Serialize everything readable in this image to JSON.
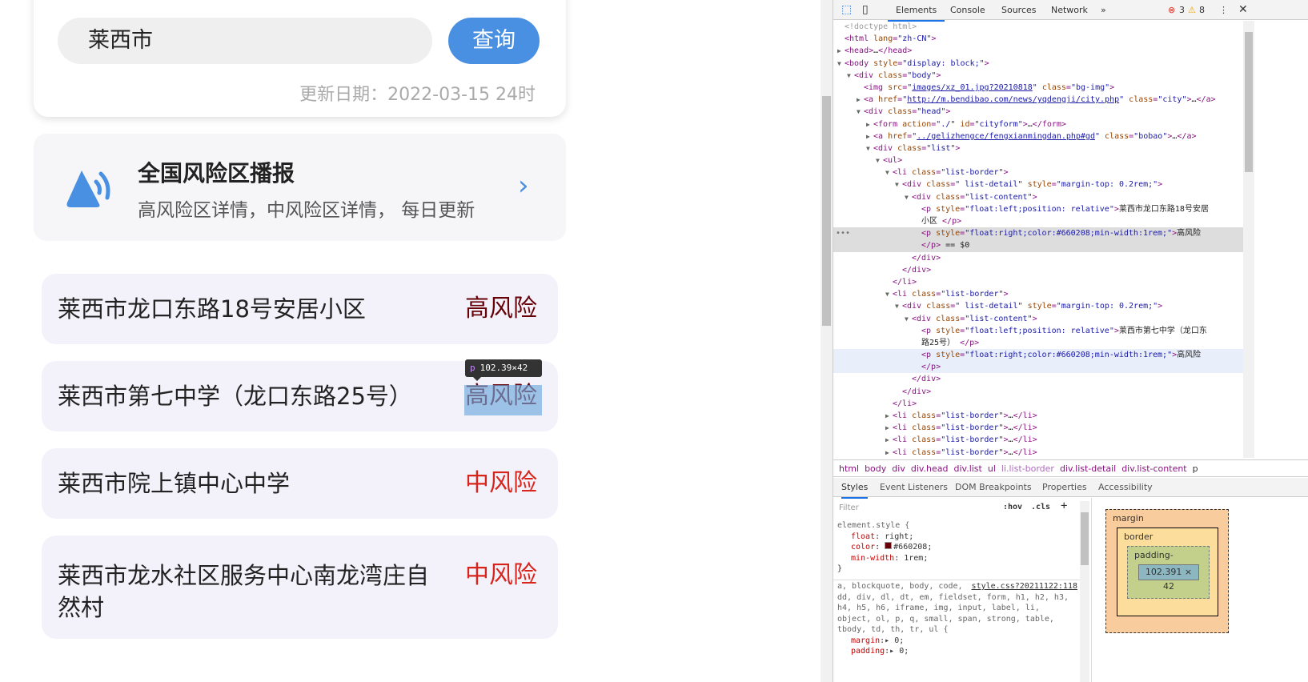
{
  "page": {
    "search_value": "莱西市",
    "search_button": "查询",
    "update_date": "更新日期：2022-03-15 24时",
    "bobao": {
      "title": "全国风险区播报",
      "subtitle": "高风险区详情，中风险区详情， 每日更新",
      "icon": "broadcast-icon"
    },
    "items": [
      {
        "name": "莱西市龙口东路18号安居小区",
        "risk": "高风险",
        "color": "#660208"
      },
      {
        "name": "莱西市第七中学（龙口东路25号）",
        "risk": "高风险",
        "color": "#660208"
      },
      {
        "name": "莱西市院上镇中心中学",
        "risk": "中风险",
        "color": "#d9241c"
      },
      {
        "name": "莱西市龙水社区服务中心南龙湾庄自然村",
        "risk": "中风险",
        "color": "#d9241c"
      }
    ],
    "tooltip": {
      "tag": "p",
      "size": "102.39×42"
    }
  },
  "devtools": {
    "tabs": [
      "Elements",
      "Console",
      "Sources",
      "Network"
    ],
    "errors": "3",
    "warnings": "8",
    "tree": [
      {
        "i": 0,
        "t": "<!doctype html>",
        "c": 1
      },
      {
        "i": 0,
        "t": "<html lang=\"zh-CN\">"
      },
      {
        "i": 0,
        "a": "▶",
        "t": "<head>…</head>"
      },
      {
        "i": 0,
        "a": "▼",
        "t": "<body style=\"display: block;\">"
      },
      {
        "i": 1,
        "a": "▼",
        "t": "<div class=\"body\">"
      },
      {
        "i": 2,
        "t": "<img src=\"images/xz_01.jpg?20210818\" class=\"bg-img\">"
      },
      {
        "i": 2,
        "a": "▶",
        "t": "<a href=\"http://m.bendibao.com/news/yqdengji/city.php\" class=\"city\">…</a>"
      },
      {
        "i": 2,
        "a": "▼",
        "t": "<div class=\"head\">"
      },
      {
        "i": 3,
        "a": "▶",
        "t": "<form action=\"./\" id=\"cityform\">…</form>"
      },
      {
        "i": 3,
        "a": "▶",
        "t": "<a href=\"../gelizhengce/fengxianmingdan.php#gd\" class=\"bobao\">…</a>"
      },
      {
        "i": 3,
        "a": "▼",
        "t": "<div class=\"list\">"
      },
      {
        "i": 4,
        "a": "▼",
        "t": "<ul>"
      },
      {
        "i": 5,
        "a": "▼",
        "t": "<li class=\"list-border\">"
      },
      {
        "i": 6,
        "a": "▼",
        "t": "<div class=\" list-detail\" style=\"margin-top: 0.2rem;\">"
      },
      {
        "i": 7,
        "a": "▼",
        "t": "<div class=\"list-content\">"
      },
      {
        "i": 8,
        "t": "<p style=\"float:left;position: relative\">莱西市龙口东路18号安居"
      },
      {
        "i": 8,
        "t": "小区 </p>"
      },
      {
        "i": 8,
        "t": "<p style=\"float:right;color:#660208;min-width:1rem;\">高风险",
        "s": 1
      },
      {
        "i": 8,
        "t": "</p> == $0",
        "s": 1
      },
      {
        "i": 7,
        "t": "</div>"
      },
      {
        "i": 6,
        "t": "</div>"
      },
      {
        "i": 5,
        "t": "</li>"
      },
      {
        "i": 5,
        "a": "▼",
        "t": "<li class=\"list-border\">"
      },
      {
        "i": 6,
        "a": "▼",
        "t": "<div class=\" list-detail\" style=\"margin-top: 0.2rem;\">"
      },
      {
        "i": 7,
        "a": "▼",
        "t": "<div class=\"list-content\">"
      },
      {
        "i": 8,
        "t": "<p style=\"float:left;position: relative\">莱西市第七中学（龙口东"
      },
      {
        "i": 8,
        "t": "路25号） </p>"
      },
      {
        "i": 8,
        "t": "<p style=\"float:right;color:#660208;min-width:1rem;\">高风险",
        "h": 1
      },
      {
        "i": 8,
        "t": "</p>",
        "h": 1
      },
      {
        "i": 7,
        "t": "</div>"
      },
      {
        "i": 6,
        "t": "</div>"
      },
      {
        "i": 5,
        "t": "</li>"
      },
      {
        "i": 5,
        "a": "▶",
        "t": "<li class=\"list-border\">…</li>"
      },
      {
        "i": 5,
        "a": "▶",
        "t": "<li class=\"list-border\">…</li>"
      },
      {
        "i": 5,
        "a": "▶",
        "t": "<li class=\"list-border\">…</li>"
      },
      {
        "i": 5,
        "a": "▶",
        "t": "<li class=\"list-border\">…</li>"
      }
    ],
    "breadcrumbs": [
      "html",
      "body",
      "div",
      "div.head",
      "div.list",
      "ul",
      "li.list-border",
      "div.list-detail",
      "div.list-content",
      "p"
    ],
    "style_tabs": [
      "Styles",
      "Event Listeners",
      "DOM Breakpoints",
      "Properties",
      "Accessibility"
    ],
    "filter_placeholder": "Filter",
    "hov": ":hov",
    "cls": ".cls",
    "element_style": {
      "selector": "element.style {",
      "props": [
        [
          "float",
          "right"
        ],
        [
          "color",
          "#660208"
        ],
        [
          "min-width",
          "1rem"
        ]
      ],
      "close": "}"
    },
    "rule": {
      "source": "style.css?20211122:118",
      "selector": "a, blockquote, body, code, dd, div, dl, dt, em, fieldset, form, h1, h2, h3, h4, h5, h6, iframe, img, input, label, li, object, ol, p, q, small, span, strong, table, tbody, td, th, tr, ul {",
      "props": [
        [
          "margin",
          "0"
        ],
        [
          "padding",
          "0"
        ]
      ]
    },
    "box": {
      "margin": "margin",
      "border": "border",
      "padding": "padding-",
      "content": "102.391 × 42",
      "dash": "–"
    }
  }
}
